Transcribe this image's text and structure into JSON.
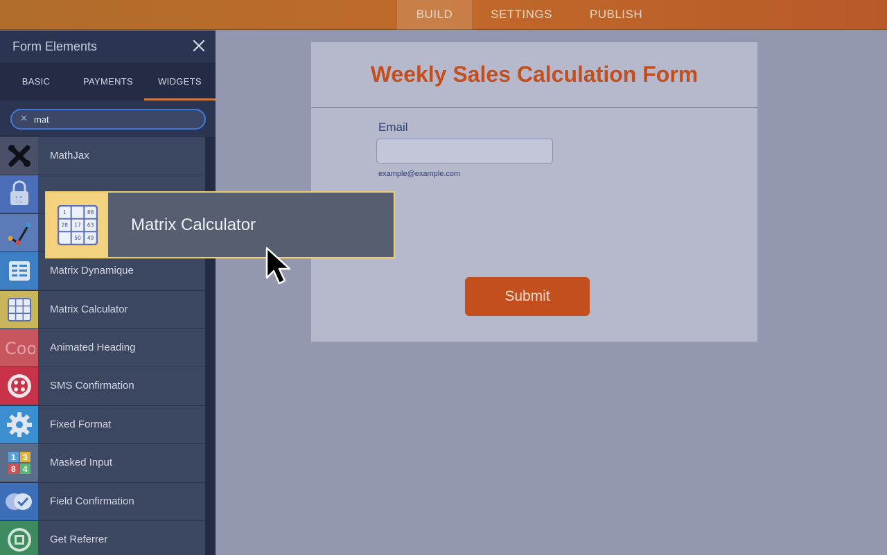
{
  "topnav": {
    "tabs": [
      "BUILD",
      "SETTINGS",
      "PUBLISH"
    ],
    "active": "BUILD"
  },
  "sidebar": {
    "title": "Form Elements",
    "tabs": [
      "BASIC",
      "PAYMENTS",
      "WIDGETS"
    ],
    "active_tab": "WIDGETS",
    "search": {
      "value": "mat"
    },
    "items": [
      {
        "label": "MathJax",
        "icon": "tools-icon",
        "bg": "#4a5068"
      },
      {
        "label": "",
        "icon": "lock-calculator-icon",
        "bg": "#4a6fb8"
      },
      {
        "label": "",
        "icon": "graph-line-icon",
        "bg": "#5a7ab8"
      },
      {
        "label": "Matrix Dynamique",
        "icon": "list-icon",
        "bg": "#3d7fc4"
      },
      {
        "label": "Matrix Calculator",
        "icon": "grid-calculator-icon",
        "bg": "#c9b55a"
      },
      {
        "label": "Animated Heading",
        "icon": "animated-text-icon",
        "bg": "#c6555d"
      },
      {
        "label": "SMS Confirmation",
        "icon": "sms-icon",
        "bg": "#c8334a"
      },
      {
        "label": "Fixed Format",
        "icon": "gear-icon",
        "bg": "#3b8fd0"
      },
      {
        "label": "Masked Input",
        "icon": "numbers-icon",
        "bg": "#5a6e8c"
      },
      {
        "label": "Field Confirmation",
        "icon": "check-bubble-icon",
        "bg": "#3d6fb8"
      },
      {
        "label": "Get Referrer",
        "icon": "referrer-icon",
        "bg": "#3d8a5e"
      }
    ]
  },
  "form": {
    "title": "Weekly Sales Calculation Form",
    "email_label": "Email",
    "email_sublabel": "example@example.com",
    "submit_label": "Submit"
  },
  "drag_ghost": {
    "label": "Matrix Calculator"
  },
  "colors": {
    "accent": "#c44f1e",
    "topbar": "#b8662b",
    "sidebar": "#2b3552"
  }
}
